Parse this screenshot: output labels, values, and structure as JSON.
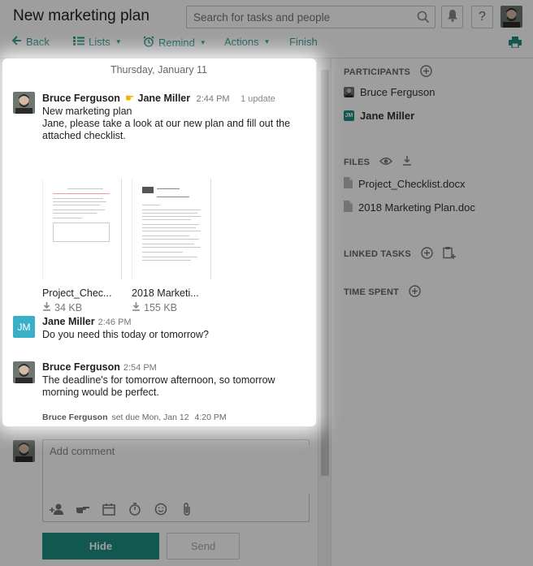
{
  "header": {
    "title": "New marketing plan",
    "search_placeholder": "Search for tasks and people",
    "notifications_icon": "bell-icon",
    "help_label": "?"
  },
  "toolbar": {
    "back": "Back",
    "lists": "Lists",
    "remind": "Remind",
    "actions": "Actions",
    "finish": "Finish",
    "accent": "#1f8f82"
  },
  "conversation": {
    "date_header": "Thursday, January 11",
    "messages": [
      {
        "author": "Bruce Ferguson",
        "assignee": "Jane Miller",
        "time": "2:44 PM",
        "updates": "1 update",
        "line1": "New marketing plan",
        "line2": "Jane, please take a look at our new plan and fill out the attached checklist.",
        "attachments": [
          {
            "name": "Project_Chec...",
            "size": "34 KB"
          },
          {
            "name": "2018 Marketi...",
            "size": "155 KB"
          }
        ]
      },
      {
        "author": "Jane Miller",
        "initials": "JM",
        "time": "2:46 PM",
        "text": "Do you need this today or tomorrow?"
      },
      {
        "author": "Bruce Ferguson",
        "time": "2:54 PM",
        "text": "The deadline's for tomorrow afternoon, so tomorrow morning would be perfect."
      }
    ],
    "system_note": {
      "author": "Bruce Ferguson",
      "action": "set due Mon, Jan 12",
      "time": "4:20 PM"
    }
  },
  "composer": {
    "placeholder": "Add comment",
    "hide_label": "Hide",
    "send_label": "Send"
  },
  "sidebar": {
    "participants_title": "PARTICIPANTS",
    "participants": [
      "Bruce Ferguson",
      "Jane Miller"
    ],
    "jm_initials": "JM",
    "files_title": "FILES",
    "files": [
      "Project_Checklist.docx",
      "2018 Marketing Plan.doc"
    ],
    "linked_title": "LINKED TASKS",
    "time_title": "TIME SPENT"
  }
}
